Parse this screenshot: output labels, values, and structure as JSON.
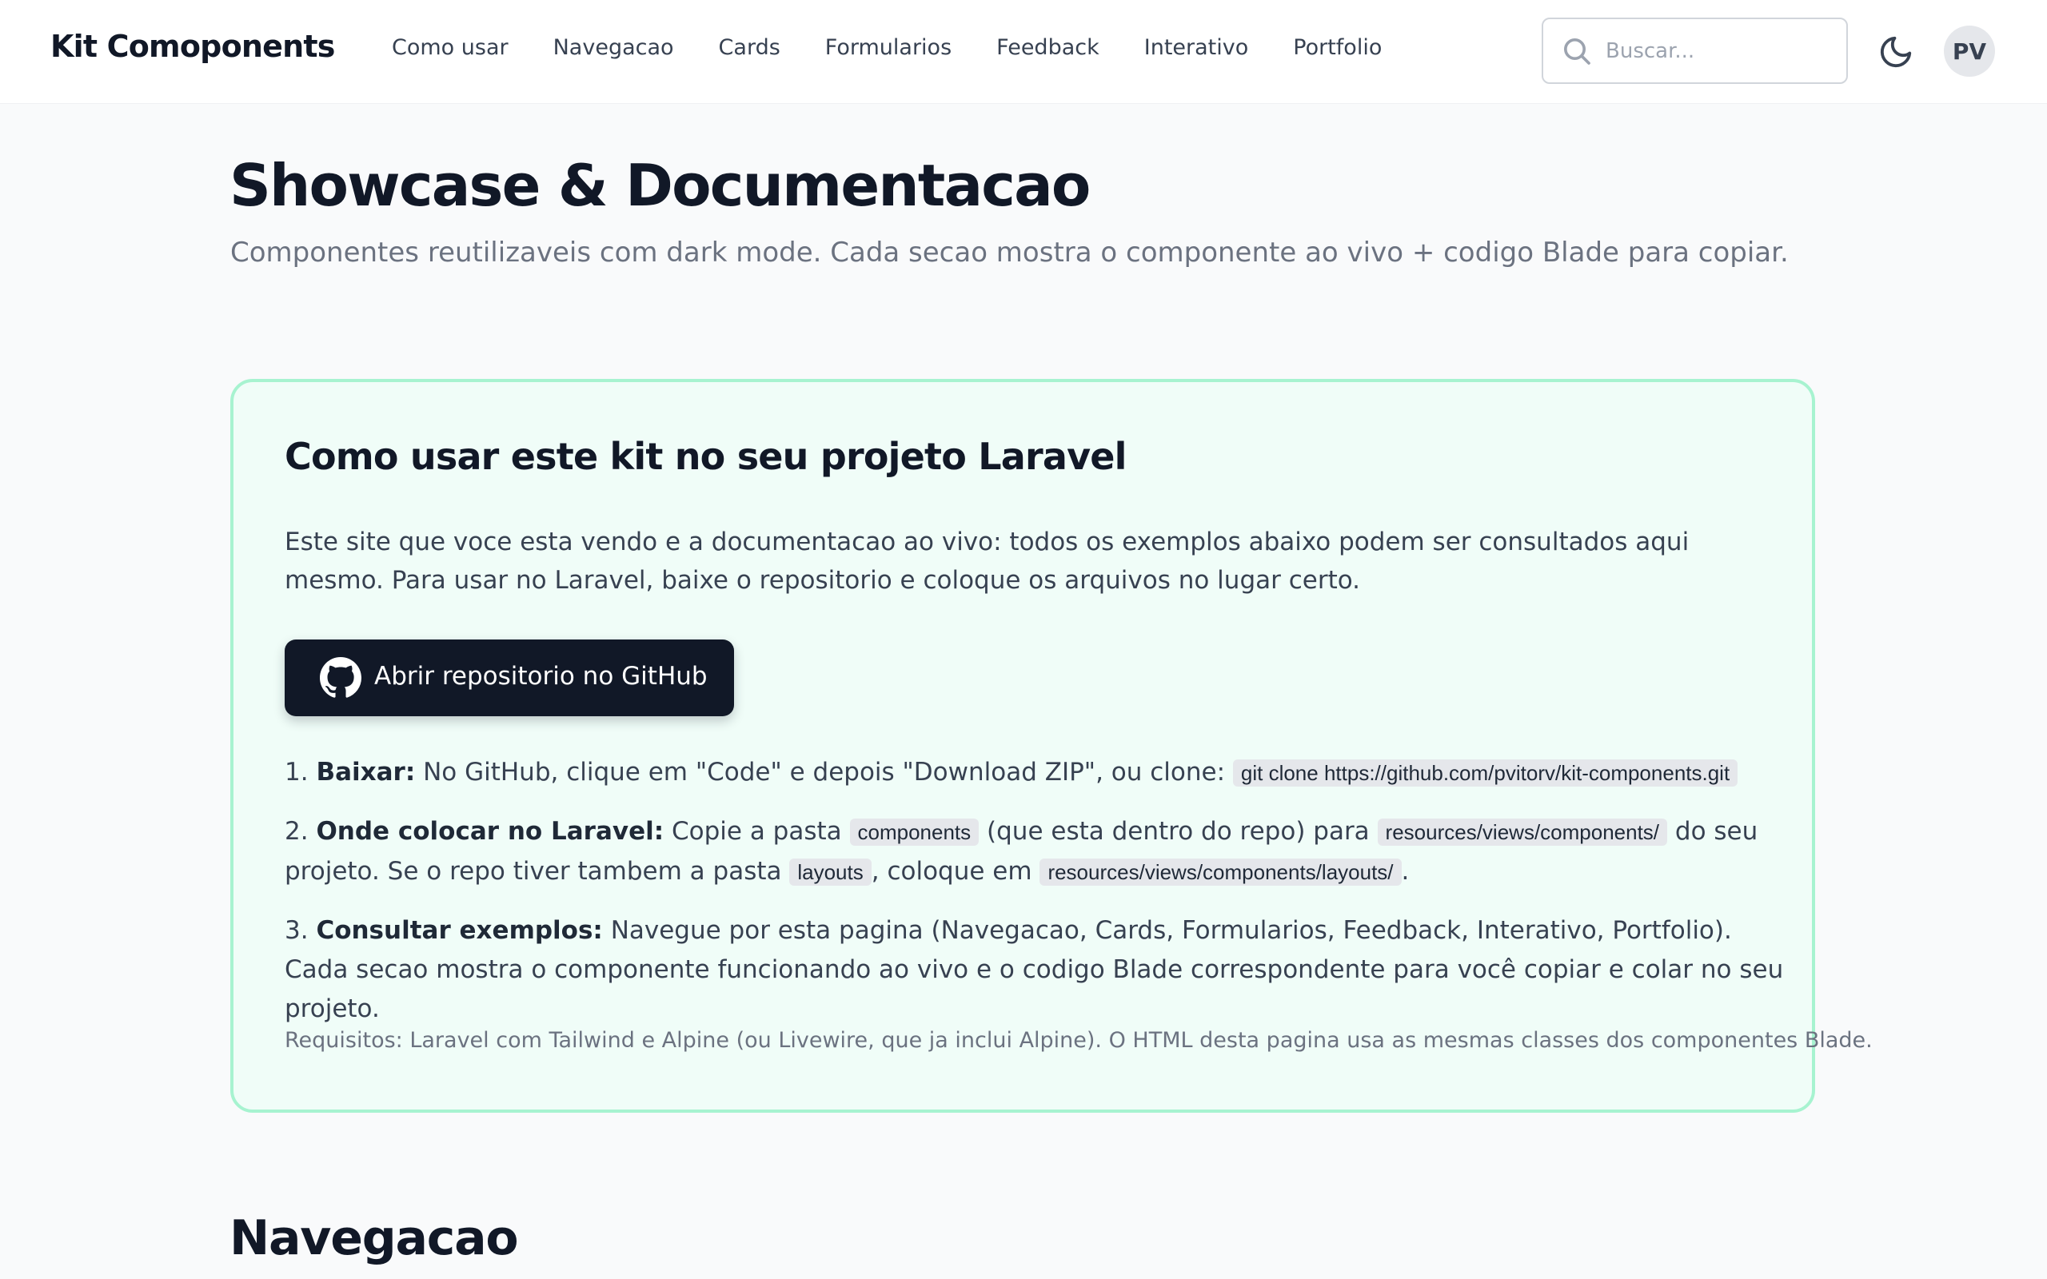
{
  "header": {
    "brand": "Kit Comoponents",
    "nav": [
      "Como usar",
      "Navegacao",
      "Cards",
      "Formularios",
      "Feedback",
      "Interativo",
      "Portfolio"
    ],
    "search_placeholder": "Buscar...",
    "avatar_initials": "PV",
    "icons": {
      "search": "search-icon",
      "theme": "moon-icon"
    }
  },
  "hero": {
    "title": "Showcase & Documentacao",
    "subtitle": "Componentes reutilizaveis com dark mode. Cada secao mostra o componente ao vivo + codigo Blade para copiar."
  },
  "howto": {
    "title": "Como usar este kit no seu projeto Laravel",
    "intro": "Este site que voce esta vendo e a documentacao ao vivo: todos os exemplos abaixo podem ser consultados aqui mesmo. Para usar no Laravel, baixe o repositorio e coloque os arquivos no lugar certo.",
    "github_button": "Abrir repositorio no GitHub",
    "step1": {
      "num": "1.",
      "label": "Baixar:",
      "text": " No GitHub, clique em \"Code\" e depois \"Download ZIP\", ou clone: ",
      "code": "git clone https://github.com/pvitorv/kit-components.git"
    },
    "step2": {
      "num": "2.",
      "label": "Onde colocar no Laravel:",
      "text_a": " Copie a pasta ",
      "code_a": "components",
      "text_b": " (que esta dentro do repo) para ",
      "code_b": "resources/views/components/",
      "text_c": " do seu projeto. Se o repo tiver tambem a pasta ",
      "code_c": "layouts",
      "text_d": ", coloque em ",
      "code_d": "resources/views/components/layouts/",
      "text_e": "."
    },
    "step3": {
      "num": "3.",
      "label": "Consultar exemplos:",
      "text": " Navegue por esta pagina (Navegacao, Cards, Formularios, Feedback, Interativo, Portfolio). Cada secao mostra o componente funcionando ao vivo e o codigo Blade correspondente para você copiar e colar no seu projeto."
    },
    "requirements": "Requisitos: Laravel com Tailwind e Alpine (ou Livewire, que ja inclui Alpine). O HTML desta pagina usa as mesmas classes dos componentes Blade."
  },
  "next_section": {
    "title": "Navegacao"
  },
  "colors": {
    "primary": "#111827",
    "card_bg": "#f0fdf8",
    "card_border": "#a7f3d0",
    "muted": "#6b7280",
    "page_bg": "#f9fafb"
  }
}
